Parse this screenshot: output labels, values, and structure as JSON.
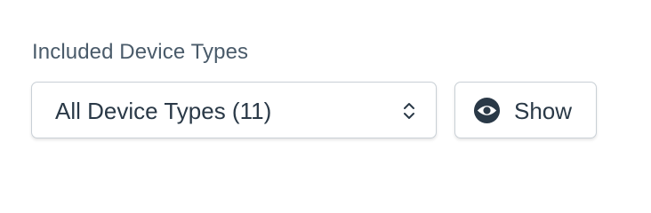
{
  "filter": {
    "label": "Included Device Types",
    "selected_value": "All Device Types (11)",
    "chevron_icon": "chevron-up-down-icon"
  },
  "show_button": {
    "label": "Show",
    "icon": "eye-icon"
  },
  "colors": {
    "text": "#2a3947",
    "label_text": "#4a5b6a",
    "border": "#c9d0d6",
    "icon": "#2a3947"
  }
}
